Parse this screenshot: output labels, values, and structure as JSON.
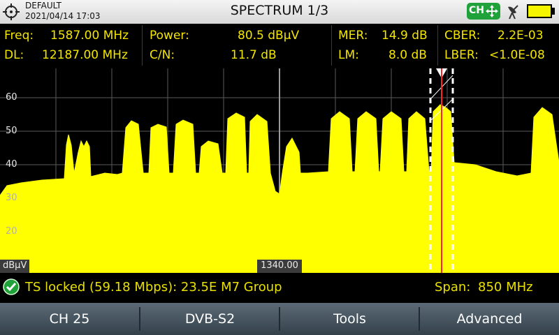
{
  "header": {
    "profile": "DEFAULT",
    "datetime": "2021/04/14 17:03",
    "title": "SPECTRUM 1/3",
    "ch_badge": "CH",
    "icons": [
      "crosshair-icon",
      "move-arrows-icon",
      "satellite-dish-icon",
      "battery-icon"
    ]
  },
  "measurements": {
    "freq_label": "Freq:",
    "freq_value": "1587.00 MHz",
    "dl_label": "DL:",
    "dl_value": "12187.00 MHz",
    "power_label": "Power:",
    "power_value": "80.5 dBµV",
    "cn_label": "C/N:",
    "cn_value": "11.7 dB",
    "mer_label": "MER:",
    "mer_value": "14.9 dB",
    "lm_label": "LM:",
    "lm_value": "8.0 dB",
    "cber_label": "CBER:",
    "cber_value": "2.2E-03",
    "lber_label": "LBER:",
    "lber_value": "<1.0E-08"
  },
  "spectrum": {
    "y_ticks": [
      "60",
      "50",
      "40",
      "30",
      "20"
    ],
    "unit": "dBµV",
    "center_freq": "1340.00",
    "trace_color": "#ffff00",
    "marker_color": "#ff2020"
  },
  "status": {
    "message": "TS locked (59.18 Mbps): 23.5E M7 Group",
    "span_label": "Span:",
    "span_value": "850 MHz",
    "lock_color": "#1fa23a"
  },
  "softkeys": [
    "CH 25",
    "DVB-S2",
    "Tools",
    "Advanced"
  ]
}
